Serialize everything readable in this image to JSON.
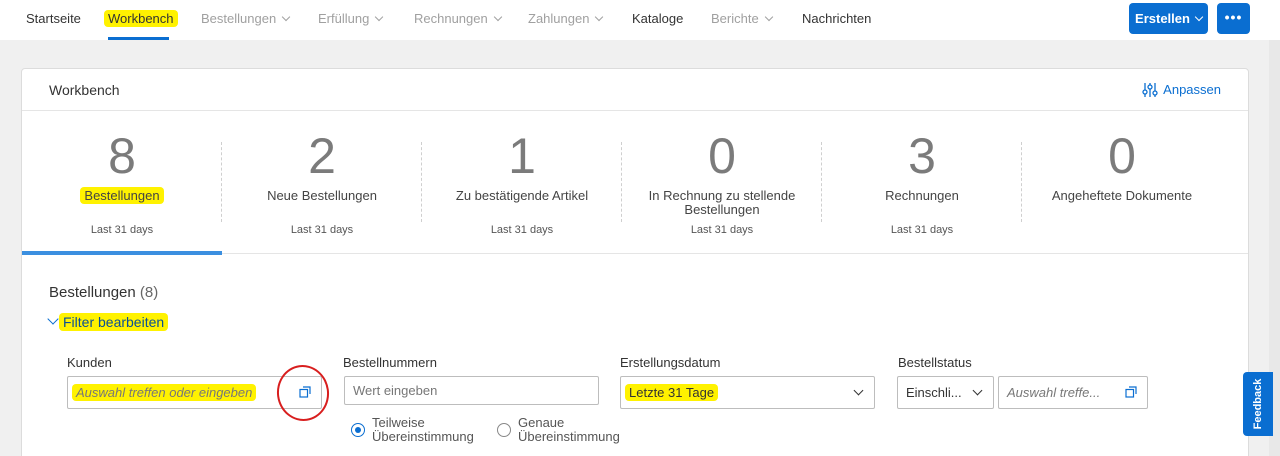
{
  "nav": {
    "items": [
      {
        "label": "Startseite"
      },
      {
        "label": "Workbench"
      },
      {
        "label": "Bestellungen"
      },
      {
        "label": "Erfüllung"
      },
      {
        "label": "Rechnungen"
      },
      {
        "label": "Zahlungen"
      },
      {
        "label": "Kataloge"
      },
      {
        "label": "Berichte"
      },
      {
        "label": "Nachrichten"
      }
    ],
    "create_label": "Erstellen",
    "more_label": "•••"
  },
  "card": {
    "title": "Workbench",
    "customize_label": "Anpassen"
  },
  "tiles": [
    {
      "value": "8",
      "label": "Bestellungen",
      "period": "Last 31 days"
    },
    {
      "value": "2",
      "label": "Neue Bestellungen",
      "period": "Last 31 days"
    },
    {
      "value": "1",
      "label": "Zu bestätigende Artikel",
      "period": "Last 31 days"
    },
    {
      "value": "0",
      "label": "In Rechnung zu stellende Bestellungen",
      "period": "Last 31 days"
    },
    {
      "value": "3",
      "label": "Rechnungen",
      "period": "Last 31 days"
    },
    {
      "value": "0",
      "label": "Angeheftete Dokumente",
      "period": ""
    }
  ],
  "section": {
    "title": "Bestellungen",
    "count": "(8)",
    "filter_toggle": "Filter bearbeiten"
  },
  "filters": {
    "customers": {
      "label": "Kunden",
      "placeholder": "Auswahl treffen oder eingeben"
    },
    "order_numbers": {
      "label": "Bestellnummern",
      "placeholder": "Wert eingeben",
      "match_partial": "Teilweise Übereinstimmung",
      "match_exact": "Genaue Übereinstimmung"
    },
    "creation_date": {
      "label": "Erstellungsdatum",
      "value": "Letzte 31 Tage"
    },
    "order_status": {
      "label": "Bestellstatus",
      "operator": "Einschli...",
      "placeholder": "Auswahl treffe..."
    }
  },
  "feedback_label": "Feedback",
  "colors": {
    "accent": "#0a6ed1",
    "highlight": "#fff200",
    "annotation": "#d81e1e"
  }
}
